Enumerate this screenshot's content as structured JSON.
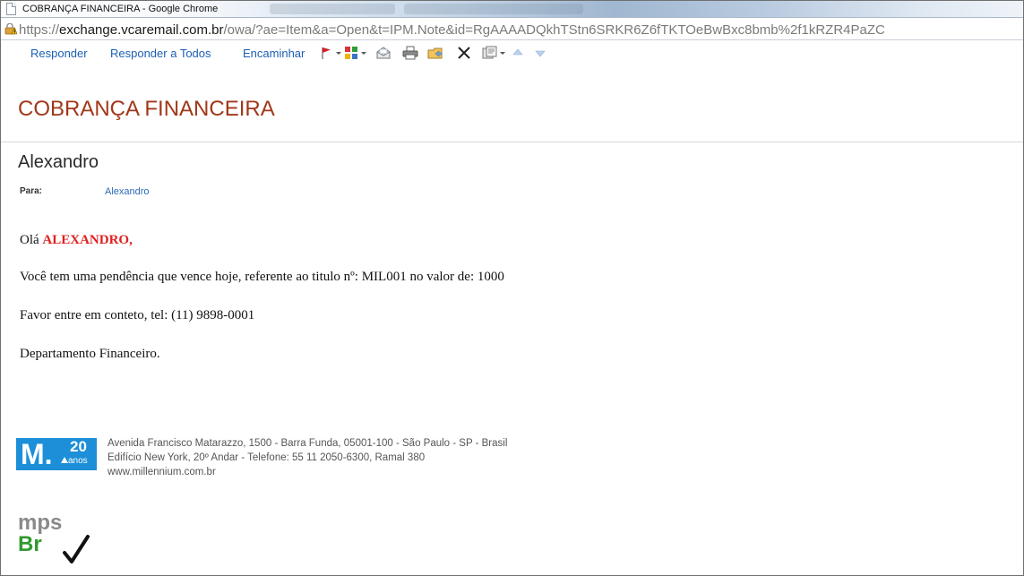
{
  "window": {
    "title": "COBRANÇA FINANCEIRA - Google Chrome"
  },
  "address": {
    "scheme": "https://",
    "host": "exchange.vcaremail.com.br",
    "rest": "/owa/?ae=Item&a=Open&t=IPM.Note&id=RgAAAADQkhTStn6SRKR6Z6fTKTOeBwBxc8bmb%2f1kRZR4PaZC"
  },
  "toolbar": {
    "reply": "Responder",
    "reply_all": "Responder a Todos",
    "forward": "Encaminhar"
  },
  "message": {
    "subject": "COBRANÇA FINANCEIRA",
    "sender": "Alexandro",
    "to_label": "Para:",
    "to_name": "Alexandro",
    "greeting_prefix": "Olá ",
    "greeting_name": "ALEXANDRO,",
    "line1": "Você tem uma pendência que vence hoje, referente ao titulo nº: MIL001 no valor de: 1000",
    "line2": "Favor entre em conteto, tel: (11) 9898-0001",
    "line3": "Departamento Financeiro."
  },
  "signature": {
    "logo_letter": "M.",
    "logo_number": "20",
    "logo_sub": "anos",
    "address1": "Avenida Francisco Matarazzo, 1500 - Barra Funda, 05001-100 - São Paulo - SP - Brasil",
    "address2": "Edifício New York, 20º Andar - Telefone: 55 11 2050-6300, Ramal 380",
    "website": "www.millennium.com.br",
    "mps_top": "mps",
    "mps_br": "Br"
  },
  "colors": {
    "link": "#1c5fb4",
    "subject": "#a0381a",
    "highlight_name": "#e02020",
    "logo_blue": "#1c8fd8",
    "mps_green": "#2f9a2f"
  }
}
